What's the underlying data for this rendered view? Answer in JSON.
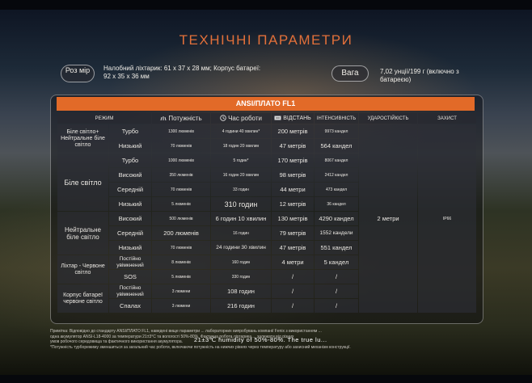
{
  "title": "ТЕХНІЧНІ ПАРАМЕТРИ",
  "size_pill": "Роз мір",
  "size_spec": "Налобний ліхтарик: 61 x 37 x 28 мм; Корпус батареї: 92 x 35 x 36 мм",
  "weight_pill": "Вага",
  "weight_spec": "7,02 унції/199 г (включно з батареєю)",
  "table_title": "ANSI/ПЛАТО FL1",
  "headers": {
    "mode": "РЕЖИМ",
    "power": "Потужність",
    "runtime": "Час роботи",
    "distance": "ВІДСТАНЬ",
    "intensity": "ІНТЕНСИВНІСТЬ",
    "impact": "УДАРОСТІЙКІСТЬ",
    "protection": "ЗАХИСТ"
  },
  "groups": {
    "g1": "Біле світло+ Нейтральне біле світло",
    "g2": "Біле світло",
    "g3": "Нейтральне біле світло",
    "g4": "Ліхтар - Червоне світло",
    "g5": "Корпус батареї червоне світло"
  },
  "rows": [
    {
      "mode": "Турбо",
      "power": "1300 люменів",
      "runtime": "4 години 40 хвилин*",
      "distance": "200 метрів",
      "intensity": "9973 кандел"
    },
    {
      "mode": "Низький",
      "power": "70 люменів",
      "runtime": "18 годин 20 хвилин",
      "distance": "47 метрів",
      "intensity": "564 кандел"
    },
    {
      "mode": "Турбо",
      "power": "1000 люменів",
      "runtime": "5 годин*",
      "distance": "170 метрів",
      "intensity": "8067 кандел"
    },
    {
      "mode": "Високий",
      "power": "350 люменів",
      "runtime": "16 годин 20 хвилин",
      "distance": "98 метрів",
      "intensity": "2412 кандел"
    },
    {
      "mode": "Середній",
      "power": "70 люменів",
      "runtime": "33 годин",
      "distance": "44 метри",
      "intensity": "473 кандел"
    },
    {
      "mode": "Низький",
      "power": "5 люменів",
      "runtime": "310 годин",
      "distance": "12 метрів",
      "intensity": "36 кандел"
    },
    {
      "mode": "Високий",
      "power": "500 люменів",
      "runtime": "6 годин 10 хвилин",
      "distance": "130 метрів",
      "intensity": "4290 кандел"
    },
    {
      "mode": "Середній",
      "power": "200 люменів",
      "runtime": "16 годин",
      "distance": "79 метрів",
      "intensity": "1552 кандели"
    },
    {
      "mode": "Низький",
      "power": "70 люменів",
      "runtime": "24 години 30 хвилин",
      "distance": "47 метрів",
      "intensity": "551 кандел"
    },
    {
      "mode": "Постійно увімкнений",
      "power": "8 люменів",
      "runtime": "160 годин",
      "distance": "4 метри",
      "intensity": "5 кандел"
    },
    {
      "mode": "SOS",
      "power": "5 люменів",
      "runtime": "330 годин",
      "distance": "/",
      "intensity": "/"
    },
    {
      "mode": "Постійно увімкнений",
      "power": "3 люмени",
      "runtime": "108 годин",
      "distance": "/",
      "intensity": "/"
    },
    {
      "mode": "Спалах",
      "power": "3 люмени",
      "runtime": "216 годин",
      "distance": "/",
      "intensity": "/"
    }
  ],
  "impact_value": "2 метри",
  "protection_value": "IP66",
  "notes": [
    "Примітка: Відповідно до стандарту ANSI/ПЛАТО FL1, наведені вище параметри ... лабораторних випробувань компанії Fenix з використанням ...",
    "одна акумулятор ANSI-L18-4000 за температури 21±3°C та вологості 50%-80%. Фактична робота ліхтарика ... залежати від різних",
    "умов робочого середовища та фактичного використання акумулятора.",
    "*Потужність турборежиму зменшиться за загальний час роботи, включаючи потужність на нижчих рівнях через температуру або захисний механізм конструкції."
  ],
  "overlay": "21±3℃    humidity of 50%-80%. The true lu..."
}
